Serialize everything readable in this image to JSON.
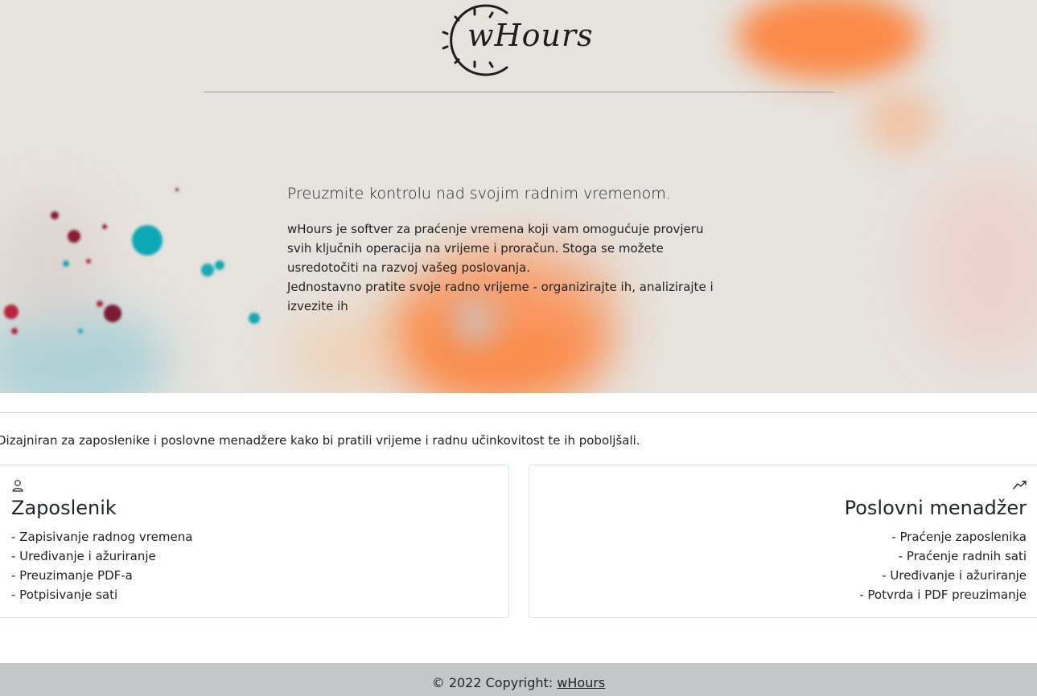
{
  "brand": {
    "name": "wHours"
  },
  "hero": {
    "heading": "Preuzmite kontrolu nad svojim radnim vremenom.",
    "paragraph_lines": [
      "wHours je softver za praćenje vremena koji vam omogućuje provjeru",
      "svih ključnih operacija na vrijeme i proračun. Stoga se možete",
      "usredotočiti na razvoj vašeg poslovanja.",
      "Jednostavno pratite svoje radno vrijeme - organizirajte ih, analizirajte i",
      "izvezite ih"
    ]
  },
  "intro": "Dizajniran za zaposlenike i poslovne menadžere kako bi pratili vrijeme i radnu učinkovitost te ih poboljšali.",
  "cards": [
    {
      "icon": "user-icon",
      "title": "Zaposlenik",
      "items": [
        "- Zapisivanje radnog vremena",
        "- Uređivanje i ažuriranje",
        "- Preuzimanje PDF-a",
        "- Potpisivanje sati"
      ]
    },
    {
      "icon": "graph-up-icon",
      "title": "Poslovni menadžer",
      "items": [
        "- Praćenje zaposlenika",
        "- Praćenje radnih sati",
        "- Uređivanje i ažuriranje",
        "- Potvrda i PDF preuzimanje"
      ]
    }
  ],
  "footer": {
    "copyright": "© 2022 Copyright:",
    "link": "wHours"
  },
  "colors": {
    "hero_bg": "#e6e2dd",
    "accent_orange": "#ff7a2e",
    "accent_teal": "#1fb3c2",
    "accent_red": "#b3283a",
    "footer_bg": "#c5c6c8"
  }
}
